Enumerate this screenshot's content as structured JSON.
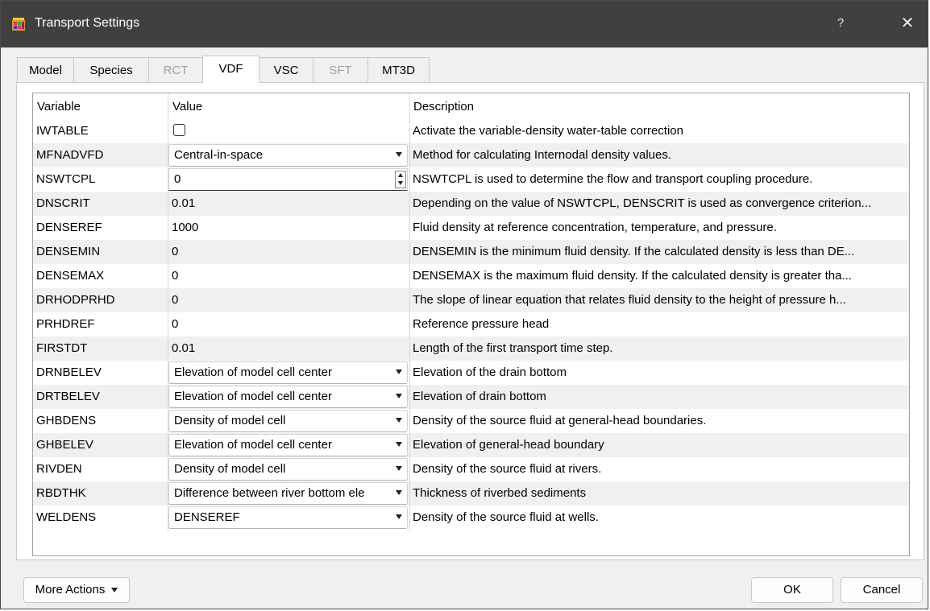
{
  "window": {
    "title": "Transport Settings",
    "help_glyph": "?",
    "close_glyph": "✕"
  },
  "tabs": [
    {
      "label": "Model",
      "state": "normal"
    },
    {
      "label": "Species",
      "state": "normal"
    },
    {
      "label": "RCT",
      "state": "disabled"
    },
    {
      "label": "VDF",
      "state": "active"
    },
    {
      "label": "VSC",
      "state": "normal"
    },
    {
      "label": "SFT",
      "state": "disabled"
    },
    {
      "label": "MT3D",
      "state": "normal"
    }
  ],
  "table": {
    "headers": {
      "variable": "Variable",
      "value": "Value",
      "description": "Description"
    },
    "rows": [
      {
        "variable": "IWTABLE",
        "value": "",
        "editor": "checkbox",
        "checked": false,
        "description": "Activate the variable-density water-table correction"
      },
      {
        "variable": "MFNADVFD",
        "value": "Central-in-space",
        "editor": "combo",
        "description": "Method for calculating Internodal density values."
      },
      {
        "variable": "NSWTCPL",
        "value": "0",
        "editor": "spin",
        "description": "NSWTCPL is used to determine the flow and transport coupling procedure."
      },
      {
        "variable": "DNSCRIT",
        "value": "0.01",
        "editor": "text",
        "description": "Depending on the value of NSWTCPL, DENSCRIT is used as convergence criterion..."
      },
      {
        "variable": "DENSEREF",
        "value": "1000",
        "editor": "text",
        "description": "Fluid density at reference concentration, temperature, and pressure."
      },
      {
        "variable": "DENSEMIN",
        "value": "0",
        "editor": "text",
        "description": "DENSEMIN is the minimum fluid density. If the calculated density is less than DE..."
      },
      {
        "variable": "DENSEMAX",
        "value": "0",
        "editor": "text",
        "description": "DENSEMAX is the maximum fluid density. If the calculated density is greater tha..."
      },
      {
        "variable": "DRHODPRHD",
        "value": "0",
        "editor": "text",
        "description": "The slope of linear equation that relates fluid density to the height of pressure h..."
      },
      {
        "variable": "PRHDREF",
        "value": "0",
        "editor": "text",
        "description": "Reference pressure head"
      },
      {
        "variable": "FIRSTDT",
        "value": "0.01",
        "editor": "text",
        "description": "Length of the first transport time step."
      },
      {
        "variable": "DRNBELEV",
        "value": "Elevation of model cell center",
        "editor": "combo",
        "description": "Elevation of the drain bottom"
      },
      {
        "variable": "DRTBELEV",
        "value": "Elevation of model cell center",
        "editor": "combo",
        "description": "Elevation of drain bottom"
      },
      {
        "variable": "GHBDENS",
        "value": "Density of model cell",
        "editor": "combo",
        "description": "Density of the source fluid at general-head boundaries."
      },
      {
        "variable": "GHBELEV",
        "value": "Elevation of model cell center",
        "editor": "combo",
        "description": "Elevation of general-head boundary"
      },
      {
        "variable": "RIVDEN",
        "value": "Density of model cell",
        "editor": "combo",
        "description": "Density of the source fluid at rivers."
      },
      {
        "variable": "RBDTHK",
        "value": "Difference between river bottom ele",
        "editor": "combo",
        "description": "Thickness of riverbed sediments"
      },
      {
        "variable": "WELDENS",
        "value": "DENSEREF",
        "editor": "combo",
        "description": "Density of the source fluid at wells."
      }
    ]
  },
  "footer": {
    "more_actions": "More Actions",
    "ok": "OK",
    "cancel": "Cancel"
  },
  "colors": {
    "titlebar": "#404040",
    "dialog_bg": "#f0f0f0",
    "row_alt": "#f0f0f0"
  }
}
